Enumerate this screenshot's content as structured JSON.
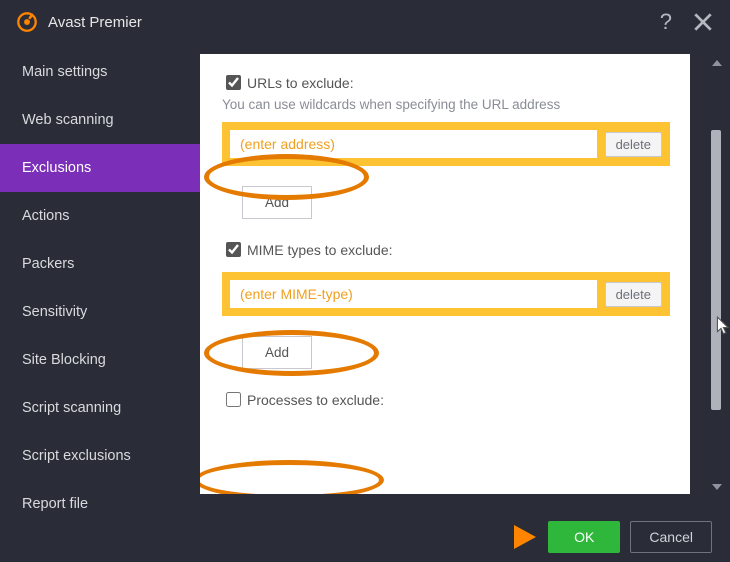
{
  "window": {
    "title": "Avast Premier"
  },
  "sidebar": {
    "items": [
      {
        "label": "Main settings"
      },
      {
        "label": "Web scanning"
      },
      {
        "label": "Exclusions"
      },
      {
        "label": "Actions"
      },
      {
        "label": "Packers"
      },
      {
        "label": "Sensitivity"
      },
      {
        "label": "Site Blocking"
      },
      {
        "label": "Script scanning"
      },
      {
        "label": "Script exclusions"
      },
      {
        "label": "Report file"
      }
    ],
    "active_index": 2
  },
  "content": {
    "sections": [
      {
        "checked": true,
        "title": "URLs to exclude:",
        "help": "You can use wildcards when specifying the URL address",
        "placeholder": "(enter address)",
        "delete_label": "delete",
        "add_label": "Add"
      },
      {
        "checked": true,
        "title": "MIME types to exclude:",
        "placeholder": "(enter MIME-type)",
        "delete_label": "delete",
        "add_label": "Add"
      },
      {
        "checked": false,
        "title": "Processes to exclude:"
      }
    ]
  },
  "footer": {
    "ok": "OK",
    "cancel": "Cancel"
  },
  "colors": {
    "accent": "#7b2fb8",
    "band": "#fec333",
    "ok": "#2fb73b",
    "highlight": "#ff8400"
  }
}
